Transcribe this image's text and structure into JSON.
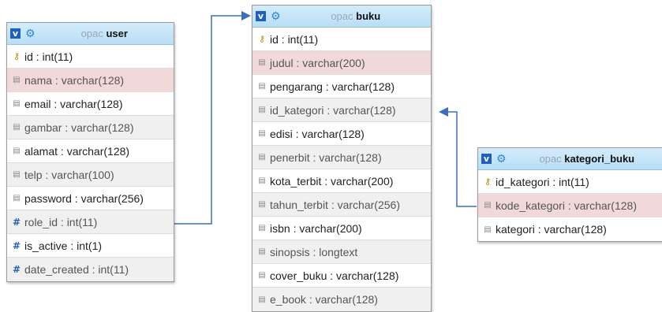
{
  "tables": [
    {
      "db": "opac",
      "name": "user",
      "rows": [
        {
          "text": "id : int(11)",
          "icon": "key-icon",
          "style": ""
        },
        {
          "text": "nama : varchar(128)",
          "icon": "column-icon",
          "style": "hl"
        },
        {
          "text": "email : varchar(128)",
          "icon": "column-icon",
          "style": ""
        },
        {
          "text": "gambar : varchar(128)",
          "icon": "column-icon",
          "style": "alt"
        },
        {
          "text": "alamat : varchar(128)",
          "icon": "column-icon",
          "style": ""
        },
        {
          "text": "telp : varchar(100)",
          "icon": "column-icon",
          "style": "alt"
        },
        {
          "text": "password : varchar(256)",
          "icon": "column-icon",
          "style": ""
        },
        {
          "text": "role_id : int(11)",
          "icon": "numeric-icon",
          "style": "alt"
        },
        {
          "text": "is_active : int(1)",
          "icon": "numeric-icon",
          "style": ""
        },
        {
          "text": "date_created : int(11)",
          "icon": "numeric-icon",
          "style": "alt"
        }
      ]
    },
    {
      "db": "opac",
      "name": "buku",
      "rows": [
        {
          "text": "id : int(11)",
          "icon": "key-icon",
          "style": ""
        },
        {
          "text": "judul : varchar(200)",
          "icon": "column-icon",
          "style": "hl"
        },
        {
          "text": "pengarang : varchar(128)",
          "icon": "column-icon",
          "style": ""
        },
        {
          "text": "id_kategori : varchar(128)",
          "icon": "column-icon",
          "style": "alt"
        },
        {
          "text": "edisi : varchar(128)",
          "icon": "column-icon",
          "style": ""
        },
        {
          "text": "penerbit : varchar(128)",
          "icon": "column-icon",
          "style": "alt"
        },
        {
          "text": "kota_terbit : varchar(200)",
          "icon": "column-icon",
          "style": ""
        },
        {
          "text": "tahun_terbit : varchar(256)",
          "icon": "column-icon",
          "style": "alt"
        },
        {
          "text": "isbn : varchar(200)",
          "icon": "column-icon",
          "style": ""
        },
        {
          "text": "sinopsis : longtext",
          "icon": "column-icon",
          "style": "alt"
        },
        {
          "text": "cover_buku : varchar(128)",
          "icon": "column-icon",
          "style": ""
        },
        {
          "text": "e_book : varchar(128)",
          "icon": "column-icon",
          "style": "alt"
        }
      ]
    },
    {
      "db": "opac",
      "name": "kategori_buku",
      "rows": [
        {
          "text": "id_kategori : int(11)",
          "icon": "key-icon",
          "style": ""
        },
        {
          "text": "kode_kategori : varchar(128)",
          "icon": "column-icon",
          "style": "hl"
        },
        {
          "text": "kategori : varchar(128)",
          "icon": "column-icon",
          "style": ""
        }
      ]
    }
  ],
  "colors": {
    "relation_line": "#3a6fbf",
    "header_bg": "#c6e6fa",
    "highlight_row": "#f2d9d9",
    "alt_row": "#f0f0f0"
  }
}
